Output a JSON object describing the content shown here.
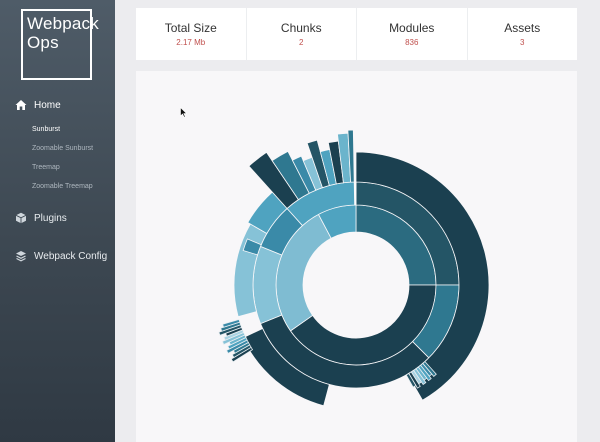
{
  "sidebar": {
    "logo_text": "Webpack Ops",
    "nav": [
      {
        "label": "Home",
        "icon": "home-icon"
      },
      {
        "label": "Plugins",
        "icon": "cube-icon"
      },
      {
        "label": "Webpack Config",
        "icon": "layers-icon"
      }
    ],
    "sub_items": [
      "Sunburst",
      "Zoomable Sunburst",
      "Treemap",
      "Zoomable Treemap"
    ]
  },
  "stats": [
    {
      "label": "Total Size",
      "value": "2.17 Mb"
    },
    {
      "label": "Chunks",
      "value": "2"
    },
    {
      "label": "Modules",
      "value": "836"
    },
    {
      "label": "Assets",
      "value": "3"
    }
  ],
  "colors": {
    "accent": "#c0504d",
    "sidebar_top": "#4f5c68",
    "sidebar_bottom": "#2f3943",
    "ring_core": "#439bbd",
    "ring_dark": "#1b4050",
    "ring_mid": "#2f7890",
    "ring_light": "#86c2d7"
  }
}
